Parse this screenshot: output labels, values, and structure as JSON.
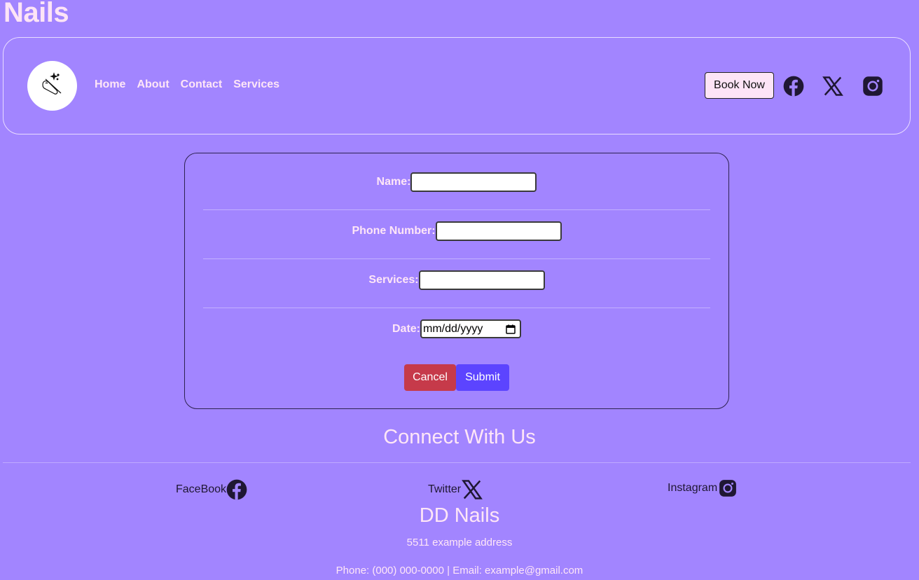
{
  "brand": {
    "title": "Nails"
  },
  "nav": {
    "items": [
      "Home",
      "About",
      "Contact",
      "Services"
    ]
  },
  "header": {
    "book_label": "Book Now"
  },
  "form": {
    "name_label": "Name:",
    "phone_label": "Phone Number:",
    "services_label": "Services:",
    "date_label": "Date:",
    "date_placeholder": "mm/dd/yyyy",
    "cancel_label": "Cancel",
    "submit_label": "Submit"
  },
  "footer": {
    "connect_title": "Connect With Us",
    "facebook_label": "FaceBook",
    "twitter_label": "Twitter",
    "instagram_label": "Instagram",
    "business_name": "DD Nails",
    "address": "5511 example address",
    "contact": "Phone: (000) 000-0000 | Email: example@gmail.com"
  },
  "colors": {
    "background": "#a285ff",
    "text": "#ffe6f7",
    "cancel": "#c63a4a",
    "submit": "#5c44ff",
    "book": "#fde4f6"
  },
  "icons": [
    "nail-logo-icon",
    "facebook-icon",
    "x-twitter-icon",
    "instagram-icon",
    "calendar-icon"
  ]
}
